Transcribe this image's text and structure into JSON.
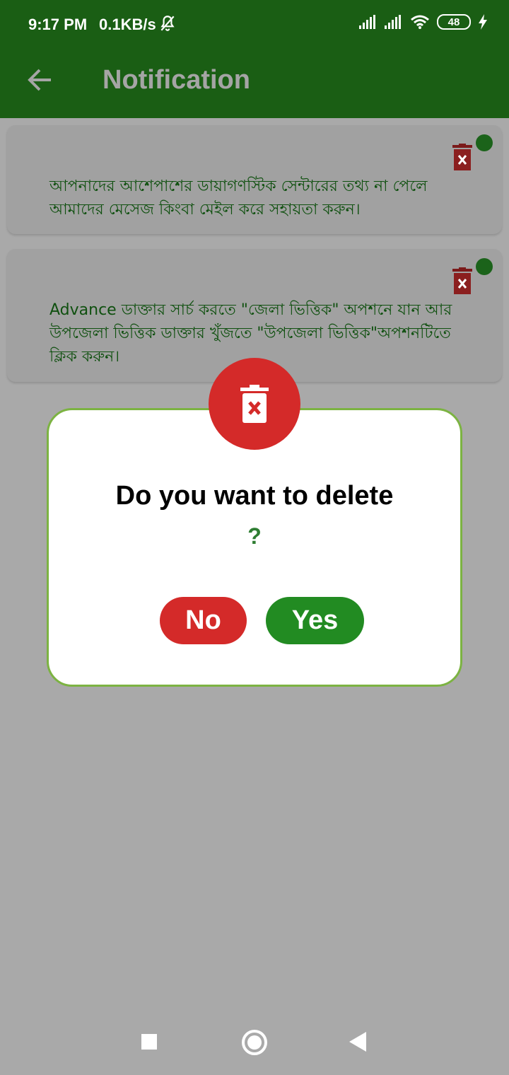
{
  "status_bar": {
    "time": "9:17 PM",
    "speed": "0.1KB/s",
    "battery": "48",
    "icons": [
      "mute-icon",
      "signal-icon",
      "signal-icon",
      "wifi-icon",
      "battery-icon",
      "charging-icon"
    ]
  },
  "app_bar": {
    "title": "Notification",
    "back_icon": "arrow-left-icon"
  },
  "notifications": [
    {
      "text": "আপনাদের আশেপাশের ডায়াগণস্টিক সেন্টারের তথ্য না পেলে আমাদের মেসেজ কিংবা মেইল করে সহায়তা করুন।",
      "delete_icon": "trash-icon",
      "unread": true
    },
    {
      "text": "Advance  ডাক্তার সার্চ করতে \"জেলা ভিত্তিক\" অপশনে যান আর উপজেলা ভিত্তিক ডাক্তার খুঁজতে \"উপজেলা ভিত্তিক\"অপশনটিতে ক্লিক করুন।",
      "delete_icon": "trash-icon",
      "unread": true
    }
  ],
  "dialog": {
    "icon": "trash-icon",
    "question": "Do you want to delete",
    "mark": "?",
    "no_label": "No",
    "yes_label": "Yes"
  },
  "colors": {
    "app_bar": "#1a5e14",
    "overlay_bg": "#a9a9a9",
    "card_text": "#0f500f",
    "delete_red": "#d42a29",
    "confirm_green": "#228b22",
    "dialog_border": "#7cb342"
  },
  "nav_bar": {
    "icons": [
      "recent-apps-icon",
      "home-icon",
      "back-icon"
    ]
  }
}
